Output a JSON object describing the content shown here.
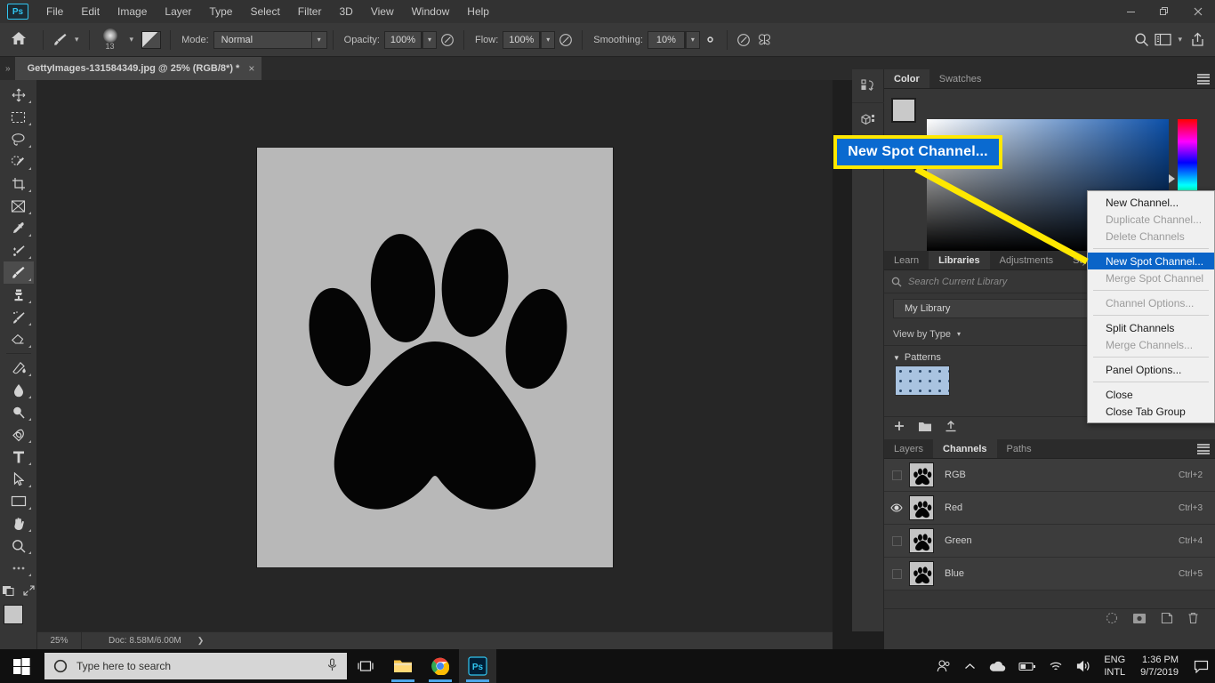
{
  "app": {
    "logo": "ps-logo",
    "menu_items": [
      "File",
      "Edit",
      "Image",
      "Layer",
      "Type",
      "Select",
      "Filter",
      "3D",
      "View",
      "Window",
      "Help"
    ],
    "window_controls": [
      "minimize",
      "restore",
      "close"
    ]
  },
  "options_bar": {
    "home_icon": "home-icon",
    "brush_preset_icon": "brush-preset-icon",
    "brush_size": "13",
    "brush_settings_icon": "brush-settings-icon",
    "mode_label": "Mode:",
    "mode_value": "Normal",
    "opacity_label": "Opacity:",
    "opacity_value": "100%",
    "opacity_pressure_icon": "pressure-opacity-icon",
    "flow_label": "Flow:",
    "flow_value": "100%",
    "airbrush_icon": "airbrush-icon",
    "smoothing_label": "Smoothing:",
    "smoothing_value": "10%",
    "smoothing_options_icon": "gear-icon",
    "pressure_size_icon": "pressure-size-icon",
    "symmetry_icon": "symmetry-butterfly-icon",
    "search_icon": "search-icon",
    "workspace_icon": "workspace-switcher-icon",
    "workspace_caret": "chevron-down-icon",
    "share_icon": "share-icon"
  },
  "document": {
    "tab_title": "GettyImages-131584349.jpg @ 25% (RGB/8*) *",
    "close_icon": "close-icon",
    "collapse_icon": "collapse-panels-icon"
  },
  "toolbar": {
    "tools": [
      {
        "name": "move-tool",
        "glyph": "move"
      },
      {
        "name": "rectangular-marquee-tool",
        "glyph": "marquee"
      },
      {
        "name": "lasso-tool",
        "glyph": "lasso"
      },
      {
        "name": "quick-selection-tool",
        "glyph": "quickselect"
      },
      {
        "name": "crop-tool",
        "glyph": "crop"
      },
      {
        "name": "frame-tool",
        "glyph": "frame"
      },
      {
        "name": "eyedropper-tool",
        "glyph": "eyedropper"
      },
      {
        "name": "spot-healing-brush-tool",
        "glyph": "healing"
      },
      {
        "name": "brush-tool",
        "glyph": "brush",
        "active": true
      },
      {
        "name": "clone-stamp-tool",
        "glyph": "stamp"
      },
      {
        "name": "history-brush-tool",
        "glyph": "historybrush"
      },
      {
        "name": "eraser-tool",
        "glyph": "eraser"
      },
      {
        "name": "gradient-tool",
        "glyph": "paintbucket"
      },
      {
        "name": "blur-tool",
        "glyph": "blur"
      },
      {
        "name": "dodge-tool",
        "glyph": "dodge"
      },
      {
        "name": "pen-tool",
        "glyph": "pen"
      },
      {
        "name": "type-tool",
        "glyph": "type"
      },
      {
        "name": "path-selection-tool",
        "glyph": "pathselect"
      },
      {
        "name": "rectangle-tool",
        "glyph": "rectangle"
      },
      {
        "name": "hand-tool",
        "glyph": "hand"
      },
      {
        "name": "zoom-tool",
        "glyph": "zoom"
      },
      {
        "name": "edit-toolbar-tool",
        "glyph": "ellipsis"
      }
    ],
    "quick_mask_icon": "quick-mask-icon",
    "screen_mode_icon": "screen-mode-icon",
    "foreground_color": "#c9c9c9",
    "background_color": "#cfcfcf"
  },
  "status_bar": {
    "zoom": "25%",
    "doc": "Doc: 8.58M/6.00M",
    "more_icon": "chevron-right-icon"
  },
  "dock_strip": {
    "buttons": [
      {
        "name": "history-panel-icon"
      },
      {
        "name": "3d-panel-icon"
      }
    ]
  },
  "color_panel": {
    "tabs": [
      {
        "label": "Color",
        "active": true
      },
      {
        "label": "Swatches",
        "active": false
      }
    ],
    "menu_icon": "panel-menu-icon",
    "foreground_color": "#c9c9c9",
    "background_color": "#cfcfcf",
    "field_base_color": "#0b4fa8",
    "hue_marker_icon": "hue-marker-icon"
  },
  "libraries_panel": {
    "tabs": [
      {
        "label": "Learn",
        "active": false
      },
      {
        "label": "Libraries",
        "active": true
      },
      {
        "label": "Adjustments",
        "active": false
      },
      {
        "label": "Styles",
        "active": false
      }
    ],
    "search_icon": "search-icon",
    "search_placeholder": "Search Current Library",
    "library_name": "My Library",
    "view_by": "View by Type",
    "view_caret": "chevron-down-icon",
    "section_label": "Patterns",
    "section_tri": "▼",
    "pattern_thumb": "pattern-thumbnail",
    "footer_icons": [
      "add-content-icon",
      "new-group-icon",
      "upload-icon"
    ]
  },
  "channels_panel": {
    "tabs": [
      {
        "label": "Layers",
        "active": false
      },
      {
        "label": "Channels",
        "active": true
      },
      {
        "label": "Paths",
        "active": false
      }
    ],
    "menu_icon": "panel-menu-icon",
    "rows": [
      {
        "label": "RGB",
        "shortcut": "Ctrl+2",
        "visible": false,
        "thumb": "paw-thumbnail"
      },
      {
        "label": "Red",
        "shortcut": "Ctrl+3",
        "visible": true,
        "thumb": "paw-thumbnail"
      },
      {
        "label": "Green",
        "shortcut": "Ctrl+4",
        "visible": false,
        "thumb": "paw-thumbnail"
      },
      {
        "label": "Blue",
        "shortcut": "Ctrl+5",
        "visible": false,
        "thumb": "paw-thumbnail"
      }
    ],
    "footer_icons": [
      "load-channel-as-selection-icon",
      "save-selection-as-channel-icon",
      "create-new-channel-icon",
      "delete-channel-icon"
    ]
  },
  "context_menu": {
    "items": [
      {
        "label": "New Channel...",
        "state": "enabled"
      },
      {
        "label": "Duplicate Channel...",
        "state": "disabled"
      },
      {
        "label": "Delete Channels",
        "state": "disabled"
      },
      {
        "separator": true
      },
      {
        "label": "New Spot Channel...",
        "state": "selected"
      },
      {
        "label": "Merge Spot Channel",
        "state": "disabled"
      },
      {
        "separator": true
      },
      {
        "label": "Channel Options...",
        "state": "disabled"
      },
      {
        "separator": true
      },
      {
        "label": "Split Channels",
        "state": "enabled"
      },
      {
        "label": "Merge Channels...",
        "state": "disabled"
      },
      {
        "separator": true
      },
      {
        "label": "Panel Options...",
        "state": "enabled"
      },
      {
        "separator": true
      },
      {
        "label": "Close",
        "state": "enabled"
      },
      {
        "label": "Close Tab Group",
        "state": "enabled"
      }
    ]
  },
  "callout": {
    "text": "New Spot Channel...",
    "border_color": "#ffe800",
    "fill_color": "#0a6ad0",
    "text_color": "#ffffff",
    "line_color": "#ffe800"
  },
  "taskbar": {
    "start_icon": "windows-start-icon",
    "search_icon": "search-circle-icon",
    "search_placeholder": "Type here to search",
    "mic_icon": "microphone-icon",
    "task_view_icon": "task-view-icon",
    "apps": [
      {
        "name": "file-explorer-icon"
      },
      {
        "name": "google-chrome-icon"
      },
      {
        "name": "photoshop-icon",
        "active": true
      }
    ],
    "tray": {
      "people_icon": "people-icon",
      "show_hidden_icon": "chevron-up-icon",
      "onedrive_icon": "onedrive-cloud-icon",
      "battery_icon": "battery-icon",
      "wifi_icon": "wifi-icon",
      "volume_icon": "speaker-icon",
      "language_line1": "ENG",
      "language_line2": "INTL",
      "time": "1:36 PM",
      "date": "9/7/2019",
      "action_center_icon": "action-center-icon"
    }
  }
}
